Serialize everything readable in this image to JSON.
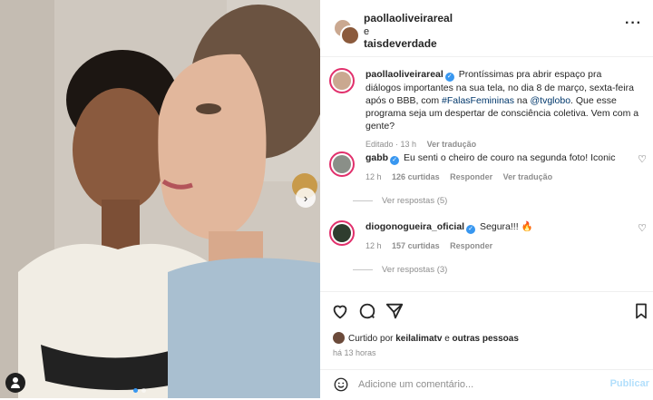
{
  "post_image": {
    "next_button": "›",
    "colors": {
      "wall": "#cfc8bf",
      "sweater": "#a9bfd0",
      "blouse": "#f1ede4",
      "lace": "#222222"
    }
  },
  "header": {
    "user1": "paollaoliveirareal",
    "separator": "e",
    "user2": "taisdeverdade",
    "more": "···"
  },
  "caption": {
    "username": "paollaoliveirareal",
    "text_before_hashtag": "Prontíssimas pra abrir espaço pra diálogos importantes na sua tela, no dia 8 de março, sexta-feira após o BBB, com ",
    "hashtag": "#FalasFemininas",
    "text_middle": " na ",
    "mention": "@tvglobo",
    "text_after": ". Que esse programa seja um despertar de consciência coletiva. Vem com a gente?",
    "edited": "Editado · 13 h",
    "translate": "Ver tradução"
  },
  "comments": [
    {
      "username": "gabb",
      "text": "Eu senti o cheiro de couro na segunda foto! Iconic",
      "time": "12 h",
      "likes": "126 curtidas",
      "reply": "Responder",
      "translate": "Ver tradução",
      "view_replies": "Ver respostas (5)"
    },
    {
      "username": "diogonogueira_oficial",
      "text": "Segura!!! 🔥",
      "time": "12 h",
      "likes": "157 curtidas",
      "reply": "Responder",
      "view_replies": "Ver respostas (3)"
    }
  ],
  "likes": {
    "prefix": "Curtido por",
    "user": "keilalimatv",
    "connector": "e",
    "others": "outras pessoas"
  },
  "time_ago": "há 13 horas",
  "composer": {
    "placeholder": "Adicione um comentário...",
    "post_label": "Publicar"
  }
}
